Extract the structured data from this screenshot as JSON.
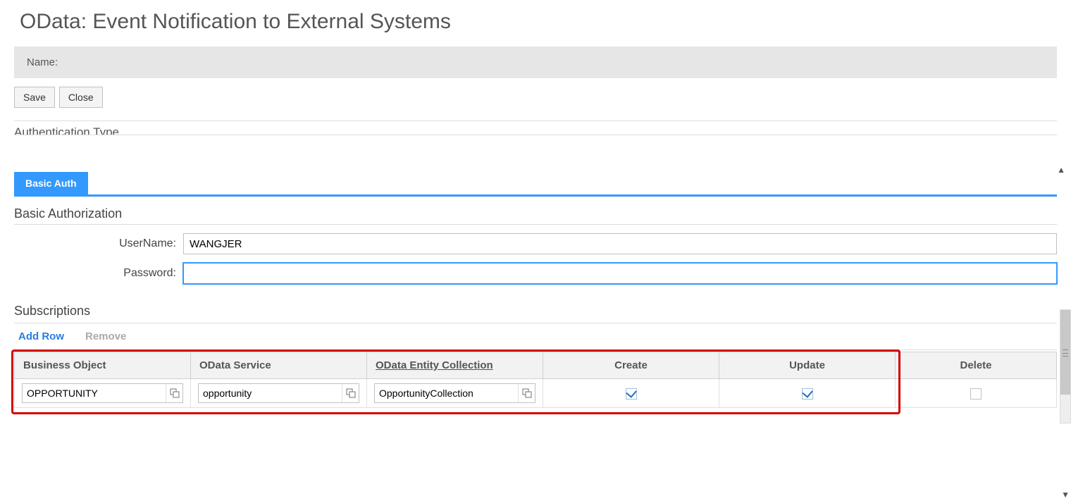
{
  "header": {
    "title": "OData: Event Notification to External Systems",
    "name_label": "Name:"
  },
  "buttons": {
    "save": "Save",
    "close": "Close"
  },
  "truncated_section": "Authentication Type",
  "tabs": {
    "basic_auth": "Basic Auth"
  },
  "basic_auth": {
    "section_title": "Basic Authorization",
    "username_label": "UserName:",
    "username_value": "WANGJER",
    "password_label": "Password:",
    "password_value": ""
  },
  "subscriptions": {
    "title": "Subscriptions",
    "add_row": "Add Row",
    "remove": "Remove",
    "columns": {
      "business_object": "Business Object",
      "odata_service": "OData Service",
      "odata_entity_collection": "OData Entity Collection",
      "create": "Create",
      "update": "Update",
      "delete": "Delete"
    },
    "rows": [
      {
        "business_object": "OPPORTUNITY",
        "odata_service": "opportunity",
        "odata_entity_collection": "OpportunityCollection",
        "create": true,
        "update": true,
        "delete": false
      }
    ]
  }
}
